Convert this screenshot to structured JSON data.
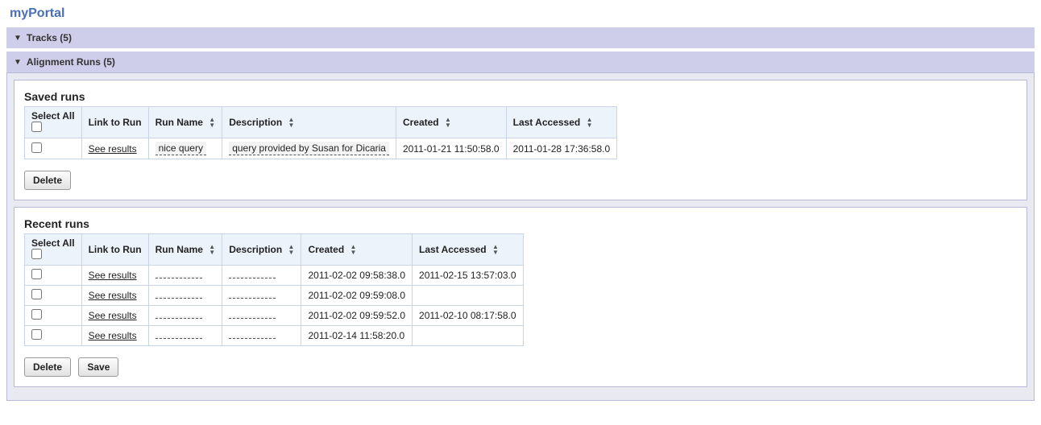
{
  "title": "myPortal",
  "panels": {
    "tracks": {
      "header": "Tracks (5)"
    },
    "alignment": {
      "header": "Alignment Runs (5)",
      "saved": {
        "title": "Saved runs",
        "columns": {
          "selectAll": "Select All",
          "link": "Link to Run",
          "runName": "Run Name",
          "description": "Description",
          "created": "Created",
          "lastAccessed": "Last Accessed"
        },
        "rows": [
          {
            "link": "See results",
            "runName": "nice query",
            "description": "query provided by Susan for Dicaria",
            "created": "2011-01-21 11:50:58.0",
            "lastAccessed": "2011-01-28 17:36:58.0"
          }
        ],
        "buttons": {
          "delete": "Delete"
        }
      },
      "recent": {
        "title": "Recent runs",
        "columns": {
          "selectAll": "Select All",
          "link": "Link to Run",
          "runName": "Run Name",
          "description": "Description",
          "created": "Created",
          "lastAccessed": "Last Accessed"
        },
        "rows": [
          {
            "link": "See results",
            "runName": "",
            "description": "",
            "created": "2011-02-02 09:58:38.0",
            "lastAccessed": "2011-02-15 13:57:03.0"
          },
          {
            "link": "See results",
            "runName": "",
            "description": "",
            "created": "2011-02-02 09:59:08.0",
            "lastAccessed": ""
          },
          {
            "link": "See results",
            "runName": "",
            "description": "",
            "created": "2011-02-02 09:59:52.0",
            "lastAccessed": "2011-02-10 08:17:58.0"
          },
          {
            "link": "See results",
            "runName": "",
            "description": "",
            "created": "2011-02-14 11:58:20.0",
            "lastAccessed": ""
          }
        ],
        "buttons": {
          "delete": "Delete",
          "save": "Save"
        }
      }
    }
  }
}
